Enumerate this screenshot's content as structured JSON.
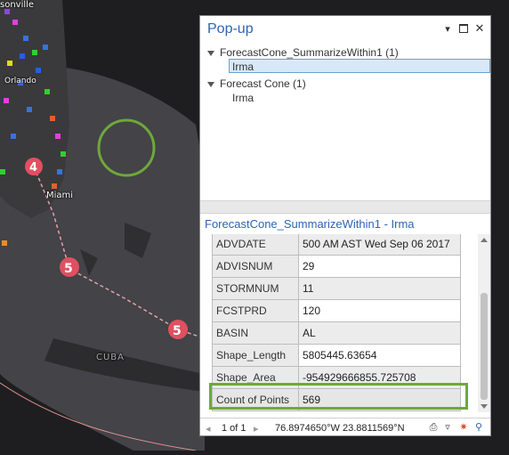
{
  "map": {
    "labels": {
      "city_top": "sonville",
      "orlando": "Orlando",
      "miami": "Miami",
      "cuba": "CUBA"
    },
    "markers": [
      "4",
      "5",
      "5"
    ]
  },
  "popup": {
    "title": "Pop-up",
    "layers": [
      {
        "label": "ForecastCone_SummarizeWithin1 (1)",
        "feature": "Irma"
      },
      {
        "label": "Forecast Cone (1)",
        "feature": "Irma"
      }
    ],
    "attr_title": "ForecastCone_SummarizeWithin1 - Irma",
    "rows": [
      {
        "key": "ADVDATE",
        "value": "500 AM AST Wed Sep 06 2017"
      },
      {
        "key": "ADVISNUM",
        "value": "29"
      },
      {
        "key": "STORMNUM",
        "value": "11"
      },
      {
        "key": "FCSTPRD",
        "value": "120"
      },
      {
        "key": "BASIN",
        "value": "AL"
      },
      {
        "key": "Shape_Length",
        "value": "5805445.63654"
      },
      {
        "key": "Shape_Area",
        "value": "-954929666855.725708"
      },
      {
        "key": "Count of Points",
        "value": "569"
      }
    ],
    "footer": {
      "page": "1 of 1",
      "coords": "76.8974650°W 23.8811569°N"
    },
    "icons": [
      "dropdown-icon",
      "maximize-icon",
      "close-icon",
      "print-icon",
      "filter-icon",
      "flash-icon",
      "zoom-icon"
    ]
  },
  "colors": {
    "title_blue": "#2d64b4",
    "highlight_green": "#6fa83a",
    "cone_fill": "#4a4a50",
    "track": "#e6a0a0"
  }
}
